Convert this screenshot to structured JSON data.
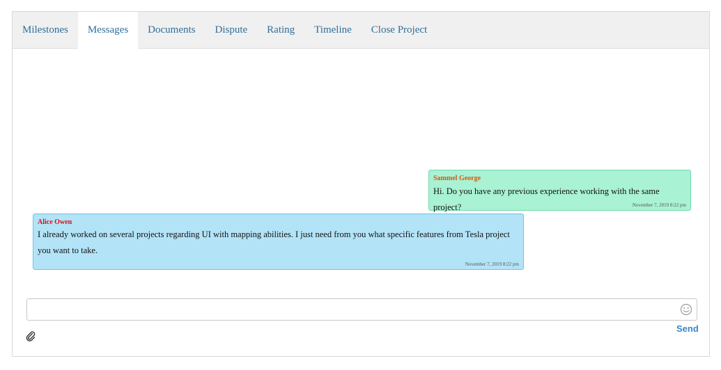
{
  "tabs": [
    {
      "label": "Milestones",
      "active": false
    },
    {
      "label": "Messages",
      "active": true
    },
    {
      "label": "Documents",
      "active": false
    },
    {
      "label": "Dispute",
      "active": false
    },
    {
      "label": "Rating",
      "active": false
    },
    {
      "label": "Timeline",
      "active": false
    },
    {
      "label": "Close Project",
      "active": false
    }
  ],
  "messages": [
    {
      "sender": "Sammel George",
      "text": "Hi. Do you have any previous experience working with the same project?",
      "time": "November 7, 2019 8:22 pm",
      "direction": "sent"
    },
    {
      "sender": "Alice Owen",
      "text": "I already worked on several projects regarding UI with mapping abilities. I just need from you what specific features from Tesla project you want to take.",
      "time": "November 7, 2019 8:22 pm",
      "direction": "received"
    }
  ],
  "composer": {
    "value": "",
    "placeholder": "",
    "send_label": "Send",
    "emoji_icon": "smiley-icon",
    "attach_icon": "paperclip-icon"
  },
  "colors": {
    "tab_text": "#2f6e99",
    "sent_bubble": "#a9f2d4",
    "received_bubble": "#b3e3f7",
    "sent_sender": "#d4570f",
    "received_sender": "#d8101a",
    "send_link": "#3a86c8"
  }
}
